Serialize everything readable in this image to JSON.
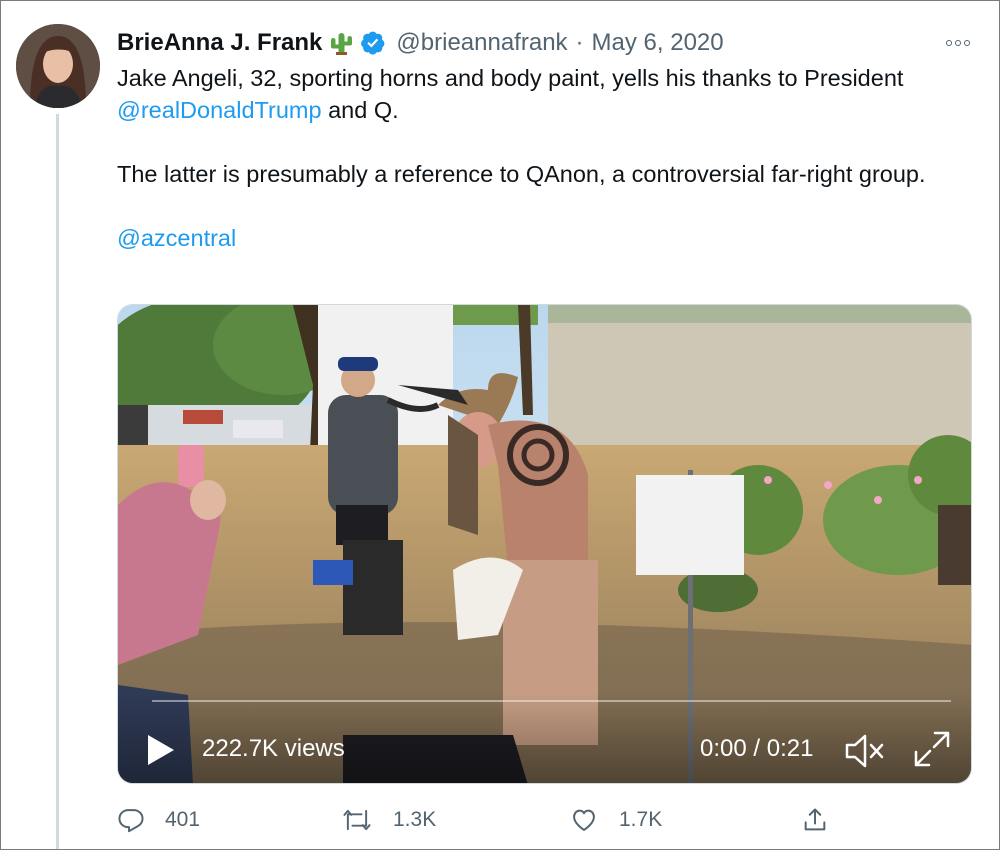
{
  "author": {
    "name": "BrieAnna J. Frank",
    "handle": "@brieannafrank",
    "separator": "·",
    "date": "May 6, 2020",
    "name_emoji": "cactus-icon",
    "verified": true
  },
  "tweet": {
    "line1_text": "Jake Angeli, 32, sporting horns and body paint, yells his thanks to President ",
    "mention_trump": "@realDonaldTrump",
    "line1_end": " and Q.",
    "paragraph2": "The latter is presumably a reference to QAnon, a controversial far-right group.",
    "mention_azcentral": "@azcentral"
  },
  "video": {
    "views": "222.7K views",
    "time": "0:00 / 0:21",
    "progress": 0
  },
  "actions": {
    "reply_count": "401",
    "retweet_count": "1.3K",
    "like_count": "1.7K"
  },
  "colors": {
    "link": "#1d9bf0",
    "verified": "#1d9bf0",
    "muted_text": "#536471"
  }
}
